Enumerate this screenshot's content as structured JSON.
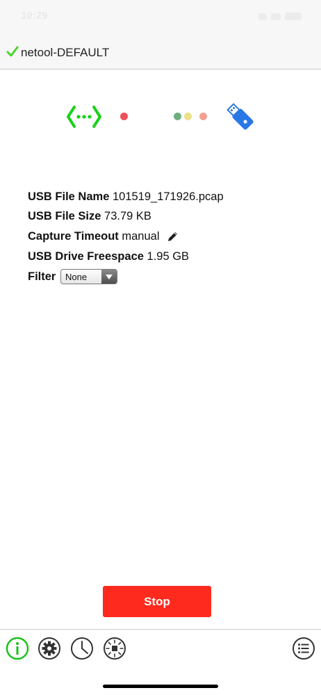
{
  "status_bar": {
    "time": "10:29"
  },
  "header": {
    "title": "netool-DEFAULT"
  },
  "colors": {
    "check": "#4cd42a",
    "ethernet": "#19d119",
    "red_dot": "#f0505a",
    "green_dot": "#6fae7f",
    "yellow_dot": "#ece08a",
    "salmon_dot": "#f4a08e",
    "usb_blue": "#2a78e6",
    "stop_button": "#fd2a1d",
    "active_tab": "#19c219"
  },
  "info": {
    "file_name_label": "USB File Name",
    "file_name_value": "101519_171926.pcap",
    "file_size_label": "USB File Size",
    "file_size_value": "73.79 KB",
    "timeout_label": "Capture Timeout",
    "timeout_value": "manual",
    "freespace_label": "USB Drive Freespace",
    "freespace_value": "1.95 GB",
    "filter_label": "Filter",
    "filter_value": "None"
  },
  "actions": {
    "stop_label": "Stop"
  },
  "tabs": [
    {
      "icon": "info-icon",
      "active": true
    },
    {
      "icon": "gear-icon",
      "active": false
    },
    {
      "icon": "clock-icon",
      "active": false
    },
    {
      "icon": "capture-icon",
      "active": false
    },
    {
      "icon": "list-icon",
      "active": false
    }
  ]
}
